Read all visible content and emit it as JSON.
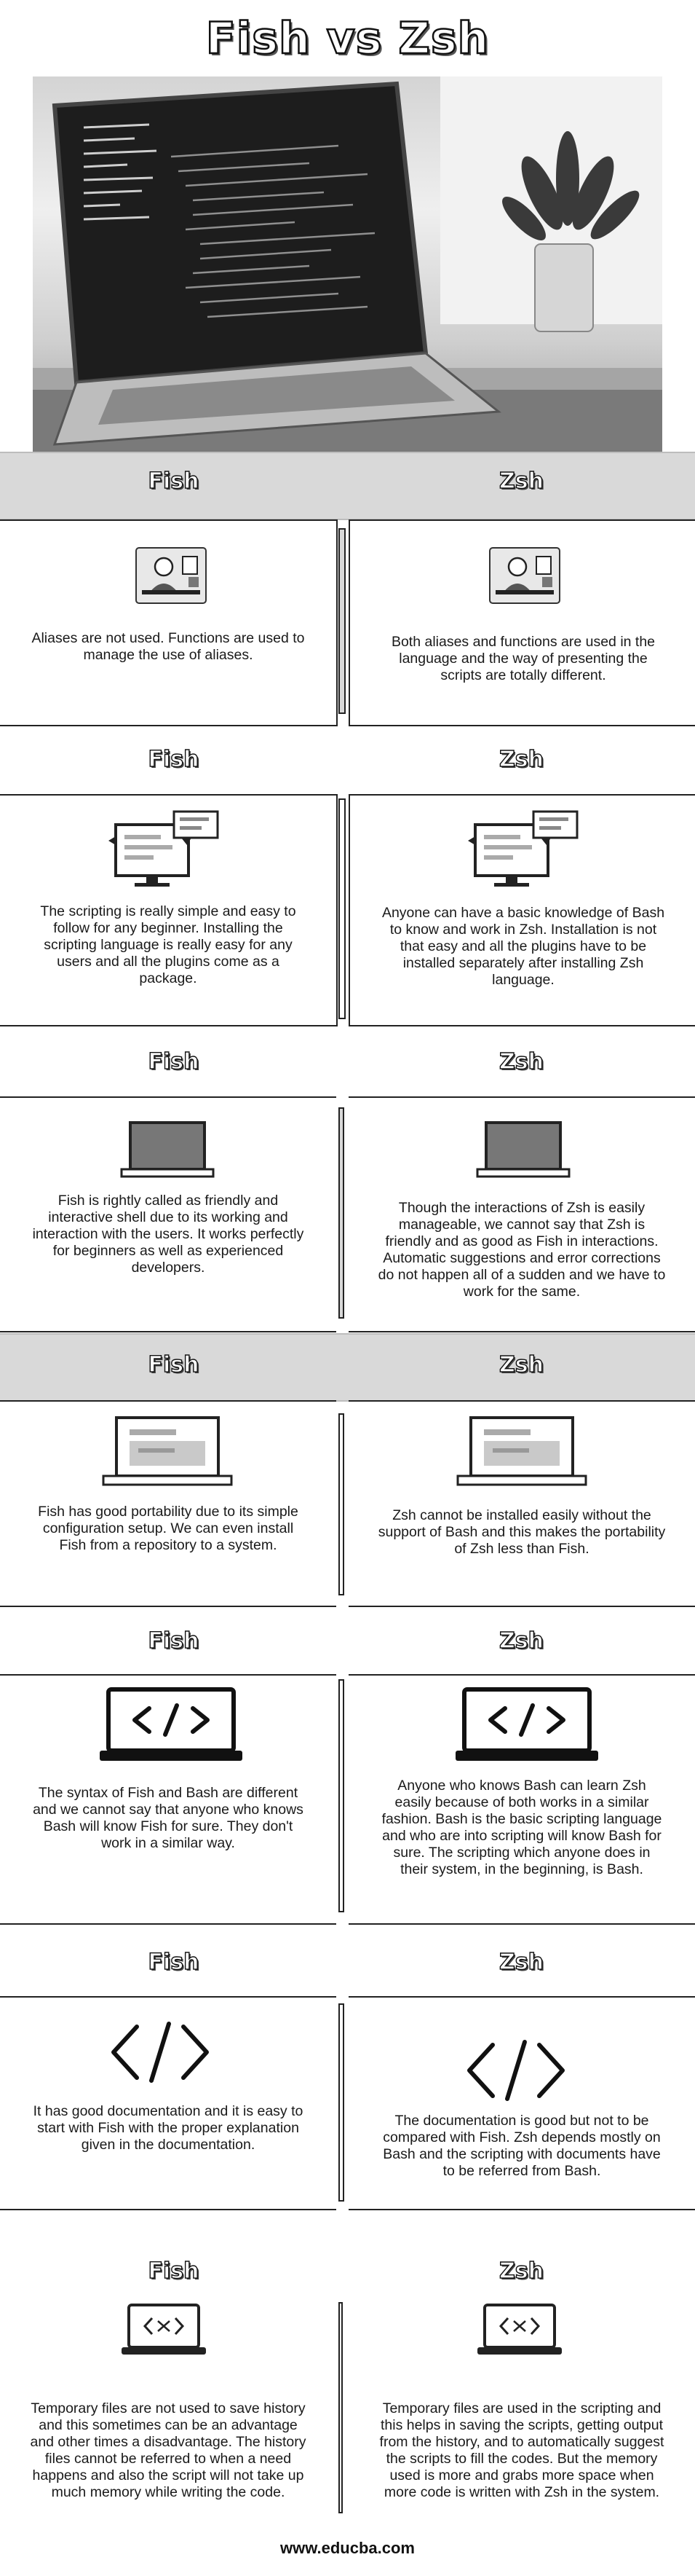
{
  "title": "Fish vs Zsh",
  "header": {
    "left": "Fish",
    "right": "Zsh"
  },
  "sections": [
    {
      "left": "Aliases are not used. Functions are used to manage the use of aliases.",
      "right": "Both aliases and functions are used in the language and the way of presenting the scripts are totally different.",
      "icon": "person-desk-icon"
    },
    {
      "left": "The scripting is really simple and easy to follow for any beginner. Installing the scripting language is really easy for any users and all the plugins come as a package.",
      "right": "Anyone can have a basic knowledge of Bash to know and work in Zsh. Installation is not that easy and all the plugins have to be installed separately after installing Zsh language.",
      "icon": "monitor-chat-icon"
    },
    {
      "left": "Fish is rightly called as friendly and interactive shell due to its working and interaction with the users. It works perfectly for beginners as well as experienced developers.",
      "right": "Though the interactions of Zsh is easily manageable, we cannot say that Zsh is friendly and as good as Fish in interactions. Automatic suggestions and error corrections do not happen all of a sudden and we have to work for the same.",
      "icon": "laptop-icon"
    },
    {
      "left": "Fish has good portability due to its simple configuration setup. We can even install Fish from a repository to a system.",
      "right": "Zsh cannot be installed easily without the support of Bash and this makes the portability of Zsh less than Fish.",
      "icon": "laptop-window-icon"
    },
    {
      "left": "The syntax of Fish and Bash are different and we cannot say that anyone who knows Bash will know Fish for sure. They don't work in a similar way.",
      "right": "Anyone who knows Bash can learn Zsh easily because of both works in a similar fashion. Bash is the basic scripting language and who are into scripting will know Bash for sure. The scripting which anyone does in their system, in the beginning, is Bash.",
      "icon": "laptop-code-icon"
    },
    {
      "left": "It has good documentation and it is easy to start with Fish with the proper explanation given in the documentation.",
      "right": "The documentation is good but not to be compared with Fish. Zsh depends mostly on Bash and the scripting with documents have to be referred from Bash.",
      "icon": "code-brackets-icon"
    },
    {
      "left": "Temporary files are not used to save history and this sometimes can be an advantage and other times a disadvantage. The history files cannot be referred to when a need happens and also the script will not take up much memory while writing the code.",
      "right": "Temporary files are used in the scripting and this helps in saving the scripts, getting output from the history, and to automatically suggest the scripts to fill the codes. But the memory used is more and grabs more space when more code is written with Zsh in the system.",
      "icon": "laptop-small-code-icon"
    }
  ],
  "footer": "www.educba.com"
}
